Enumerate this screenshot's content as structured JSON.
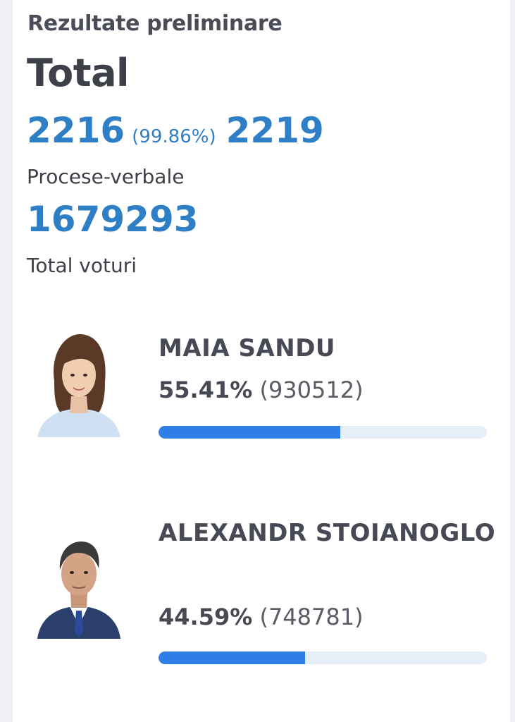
{
  "header": {
    "title": "Rezultate preliminare"
  },
  "summary": {
    "title": "Total",
    "reports_counted": "2216",
    "reports_percent": "(99.86%)",
    "reports_total": "2219",
    "reports_label": "Procese-verbale",
    "total_votes": "1679293",
    "total_votes_label": "Total voturi"
  },
  "candidates": [
    {
      "name": "MAIA SANDU",
      "percent": "55.41%",
      "votes": "(930512)",
      "share": 0.5541
    },
    {
      "name": "ALEXANDR STOIANOGLO",
      "percent": "44.59%",
      "votes": "(748781)",
      "share": 0.4459
    }
  ],
  "colors": {
    "accent": "#2f7fc7",
    "bar_fill": "#2f7ee6",
    "bar_track": "#e6eef7",
    "text": "#474a54"
  }
}
